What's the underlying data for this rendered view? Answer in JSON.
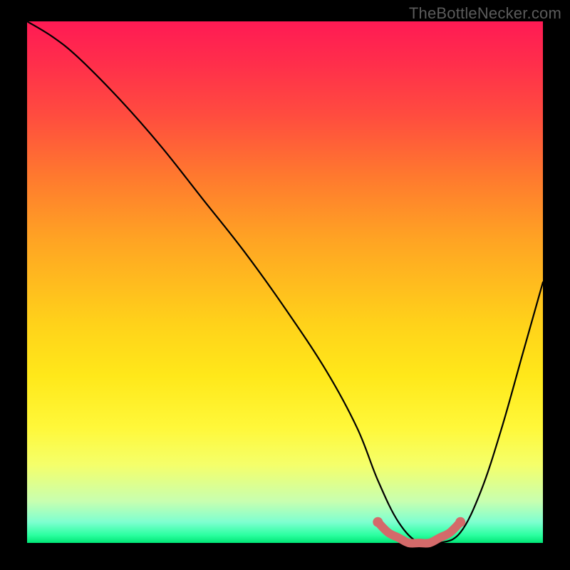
{
  "attribution": "TheBottleNecker.com",
  "chart_data": {
    "type": "line",
    "title": "",
    "xlabel": "",
    "ylabel": "",
    "xlim": [
      0,
      100
    ],
    "ylim": [
      0,
      100
    ],
    "series": [
      {
        "name": "bottleneck-curve",
        "x": [
          0,
          5,
          10,
          18,
          26,
          34,
          42,
          50,
          58,
          64,
          68,
          72,
          76,
          80,
          84,
          88,
          92,
          96,
          100
        ],
        "values": [
          100,
          97,
          93,
          85,
          76,
          66,
          56,
          45,
          33,
          22,
          12,
          4,
          0,
          0,
          2,
          10,
          22,
          36,
          50
        ]
      }
    ],
    "highlight": {
      "name": "optimal-range",
      "color": "#d46a6a",
      "x": [
        68,
        70,
        72,
        74,
        76,
        78,
        80,
        82,
        84
      ],
      "values": [
        4,
        2,
        1,
        0,
        0,
        0,
        1,
        2,
        4
      ]
    },
    "gradient_stops": [
      {
        "offset": 0,
        "color": "#ff1a54"
      },
      {
        "offset": 0.08,
        "color": "#ff2e4b"
      },
      {
        "offset": 0.18,
        "color": "#ff4c3f"
      },
      {
        "offset": 0.3,
        "color": "#ff7a2e"
      },
      {
        "offset": 0.42,
        "color": "#ffa423"
      },
      {
        "offset": 0.58,
        "color": "#ffd21a"
      },
      {
        "offset": 0.68,
        "color": "#ffe81a"
      },
      {
        "offset": 0.78,
        "color": "#fff83a"
      },
      {
        "offset": 0.85,
        "color": "#f5ff6a"
      },
      {
        "offset": 0.92,
        "color": "#c8ffb0"
      },
      {
        "offset": 0.96,
        "color": "#7effd0"
      },
      {
        "offset": 0.985,
        "color": "#2bffa0"
      },
      {
        "offset": 1.0,
        "color": "#00e676"
      }
    ]
  }
}
